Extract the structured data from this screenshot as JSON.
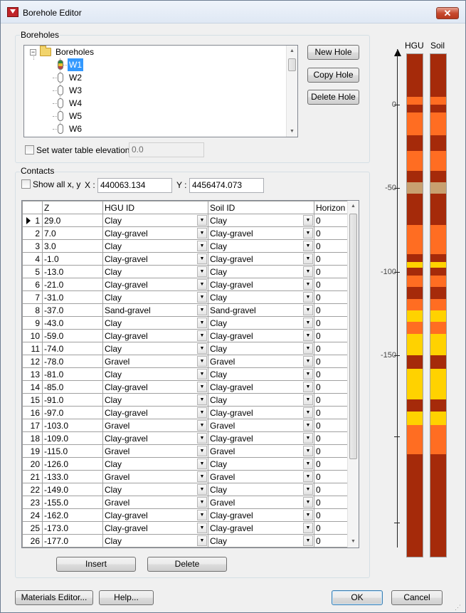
{
  "window": {
    "title": "Borehole Editor",
    "close_glyph": "✕"
  },
  "boreholes": {
    "group_label": "Boreholes",
    "root_label": "Boreholes",
    "expand_glyph": "−",
    "items": [
      "W1",
      "W2",
      "W3",
      "W4",
      "W5",
      "W6"
    ],
    "selected": "W1",
    "new_hole": "New Hole",
    "copy_hole": "Copy Hole",
    "delete_hole": "Delete Hole",
    "water_table_label": "Set water table elevation:",
    "water_table_value": "0.0"
  },
  "contacts": {
    "group_label": "Contacts",
    "show_all_label": "Show all x, y",
    "x_label": "X :",
    "x_value": "440063.134",
    "y_label": "Y :",
    "y_value": "4456474.073",
    "columns": [
      "",
      "Z",
      "HGU ID",
      "Soil ID",
      "Horizon"
    ],
    "rows": [
      [
        "1",
        "29.0",
        "Clay",
        "Clay",
        "0"
      ],
      [
        "2",
        "7.0",
        "Clay-gravel",
        "Clay-gravel",
        "0"
      ],
      [
        "3",
        "3.0",
        "Clay",
        "Clay",
        "0"
      ],
      [
        "4",
        "-1.0",
        "Clay-gravel",
        "Clay-gravel",
        "0"
      ],
      [
        "5",
        "-13.0",
        "Clay",
        "Clay",
        "0"
      ],
      [
        "6",
        "-21.0",
        "Clay-gravel",
        "Clay-gravel",
        "0"
      ],
      [
        "7",
        "-31.0",
        "Clay",
        "Clay",
        "0"
      ],
      [
        "8",
        "-37.0",
        "Sand-gravel",
        "Sand-gravel",
        "0"
      ],
      [
        "9",
        "-43.0",
        "Clay",
        "Clay",
        "0"
      ],
      [
        "10",
        "-59.0",
        "Clay-gravel",
        "Clay-gravel",
        "0"
      ],
      [
        "11",
        "-74.0",
        "Clay",
        "Clay",
        "0"
      ],
      [
        "12",
        "-78.0",
        "Gravel",
        "Gravel",
        "0"
      ],
      [
        "13",
        "-81.0",
        "Clay",
        "Clay",
        "0"
      ],
      [
        "14",
        "-85.0",
        "Clay-gravel",
        "Clay-gravel",
        "0"
      ],
      [
        "15",
        "-91.0",
        "Clay",
        "Clay",
        "0"
      ],
      [
        "16",
        "-97.0",
        "Clay-gravel",
        "Clay-gravel",
        "0"
      ],
      [
        "17",
        "-103.0",
        "Gravel",
        "Gravel",
        "0"
      ],
      [
        "18",
        "-109.0",
        "Clay-gravel",
        "Clay-gravel",
        "0"
      ],
      [
        "19",
        "-115.0",
        "Gravel",
        "Gravel",
        "0"
      ],
      [
        "20",
        "-126.0",
        "Clay",
        "Clay",
        "0"
      ],
      [
        "21",
        "-133.0",
        "Gravel",
        "Gravel",
        "0"
      ],
      [
        "22",
        "-149.0",
        "Clay",
        "Clay",
        "0"
      ],
      [
        "23",
        "-155.0",
        "Gravel",
        "Gravel",
        "0"
      ],
      [
        "24",
        "-162.0",
        "Clay-gravel",
        "Clay-gravel",
        "0"
      ],
      [
        "25",
        "-173.0",
        "Clay-gravel",
        "Clay-gravel",
        "0"
      ],
      [
        "26",
        "-177.0",
        "Clay",
        "Clay",
        "0"
      ]
    ],
    "insert": "Insert",
    "delete": "Delete"
  },
  "column_view": {
    "hgu_label": "HGU",
    "soil_label": "Soil",
    "ticks": [
      "0",
      "-50",
      "-100",
      "-150"
    ],
    "colors": {
      "Clay": "#a52a0a",
      "Clay-gravel": "#ff6d22",
      "Sand-gravel": "#c8a070",
      "Gravel": "#ffd200"
    }
  },
  "footer": {
    "materials_editor": "Materials Editor...",
    "help": "Help...",
    "ok": "OK",
    "cancel": "Cancel"
  }
}
